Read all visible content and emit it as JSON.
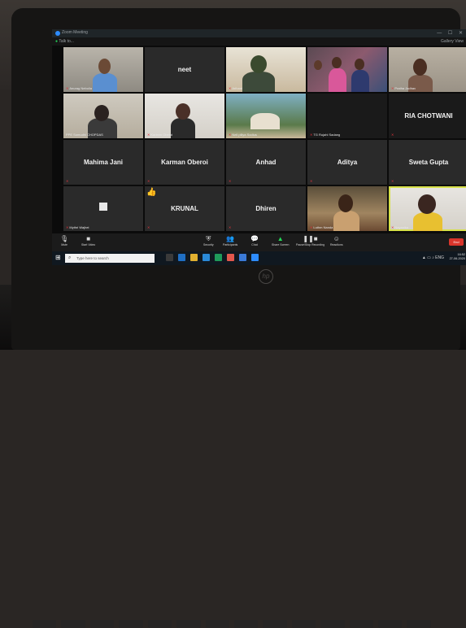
{
  "window": {
    "title": "Zoom Meeting",
    "controls": "— ☐ ✕"
  },
  "infobar": {
    "left": "Talk to...",
    "right": "Gallery View"
  },
  "tiles": [
    {
      "label": "Anurag Nebolia",
      "big": ""
    },
    {
      "label": "",
      "big": "neet"
    },
    {
      "label": "Arihant",
      "big": ""
    },
    {
      "label": "",
      "big": ""
    },
    {
      "label": "Pratha Jadhav",
      "big": ""
    },
    {
      "label": "PPE Somudhi CHOPDAS",
      "big": ""
    },
    {
      "label": "Karleen Oberoi",
      "big": ""
    },
    {
      "label": "Neil pillya Sodius",
      "big": ""
    },
    {
      "label": "TG Rujahl Sadang",
      "big": ""
    },
    {
      "label": "",
      "big": "RIA  CHOTWANI"
    },
    {
      "label": "",
      "big": "Mahima Jani"
    },
    {
      "label": "",
      "big": "Karman Oberoi"
    },
    {
      "label": "",
      "big": "Anhad"
    },
    {
      "label": "",
      "big": "Aditya"
    },
    {
      "label": "",
      "big": "Sweta Gupta"
    },
    {
      "label": "Mythri Wajhei",
      "big": ""
    },
    {
      "label": "",
      "big": "KRUNAL"
    },
    {
      "label": "",
      "big": "Dhiren"
    },
    {
      "label": "Luthm Nanda",
      "big": ""
    },
    {
      "label": "Nayanika",
      "big": ""
    }
  ],
  "toolbar": {
    "mute": "Mute",
    "start_video": "Start Video",
    "security": "Security",
    "participants": "Participants",
    "chat": "Chat",
    "share_screen": "Share Screen",
    "pause_recording": "Pause/Stop Recording",
    "reactions": "Reactions",
    "end": "End"
  },
  "taskbar": {
    "search_placeholder": "Type here to search",
    "time": "16:52",
    "date": "27-06-2020",
    "tray": "ENG"
  },
  "colors": {
    "active_speaker": "#d7e14a",
    "mic_muted": "#e0333b",
    "end_button": "#d9352b"
  }
}
